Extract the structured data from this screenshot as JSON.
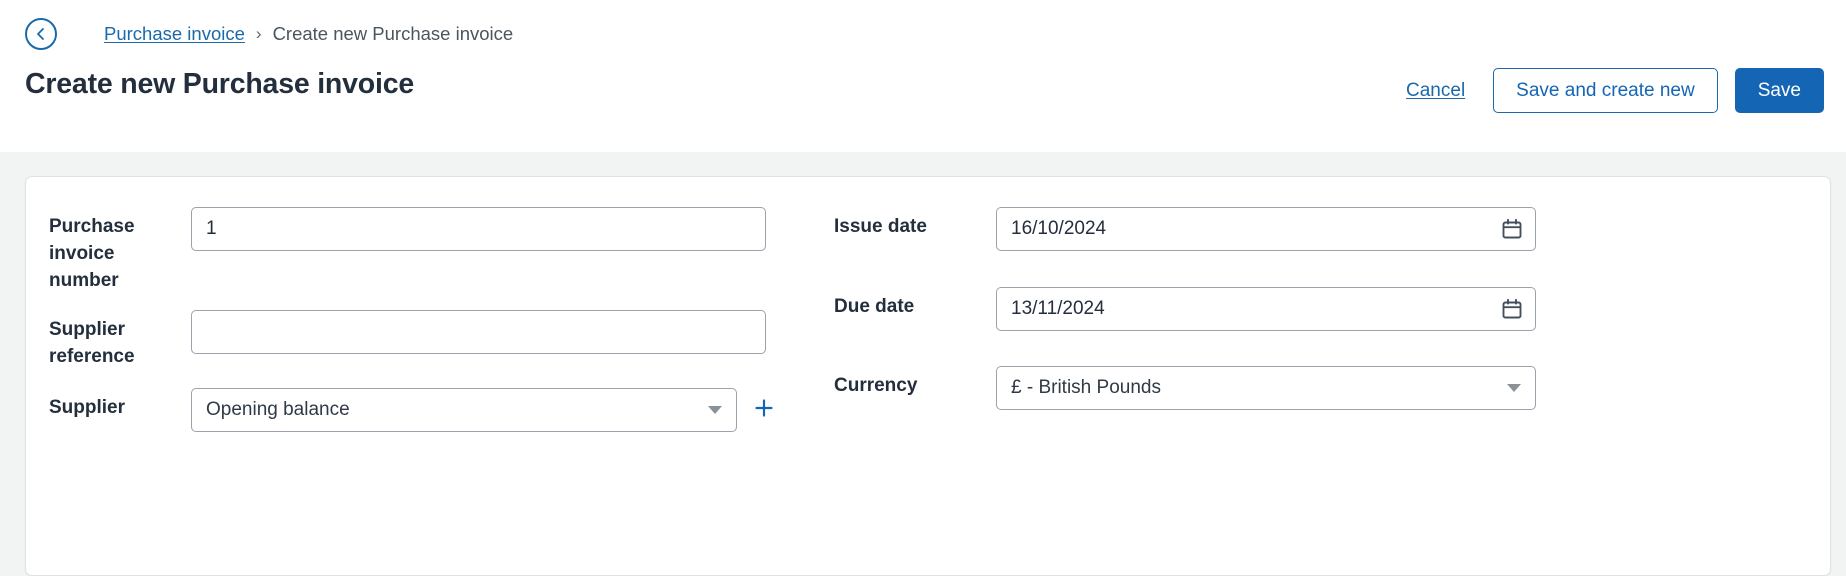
{
  "breadcrumb": {
    "back_icon": "chevron-left-circle-icon",
    "parent": "Purchase invoice",
    "separator": "›",
    "current": "Create new Purchase invoice"
  },
  "header": {
    "title": "Create new Purchase invoice",
    "cancel_label": "Cancel",
    "save_and_create_new_label": "Save and create new",
    "save_label": "Save"
  },
  "colors": {
    "accent_blue": "#1565b5",
    "link_blue": "#1a6aab",
    "title_navy": "#242f3d",
    "page_bg": "#f2f4f4",
    "card_bg": "#ffffff",
    "input_border": "#9aa3ab"
  },
  "form": {
    "left": [
      {
        "label": "Purchase invoice number",
        "name": "purchase-invoice-number",
        "type": "text",
        "value": "1",
        "placeholder": ""
      },
      {
        "label": "Supplier reference",
        "name": "supplier-reference",
        "type": "text",
        "value": "",
        "placeholder": ""
      },
      {
        "label": "Supplier",
        "name": "supplier",
        "type": "select",
        "value": "Opening balance",
        "add_icon": "plus-icon"
      }
    ],
    "right": [
      {
        "label": "Issue date",
        "name": "issue-date",
        "type": "date",
        "value": "16/10/2024",
        "icon": "calendar-icon"
      },
      {
        "label": "Due date",
        "name": "due-date",
        "type": "date",
        "value": "13/11/2024",
        "icon": "calendar-icon"
      },
      {
        "label": "Currency",
        "name": "currency",
        "type": "select",
        "value": "£ - British Pounds"
      }
    ]
  }
}
